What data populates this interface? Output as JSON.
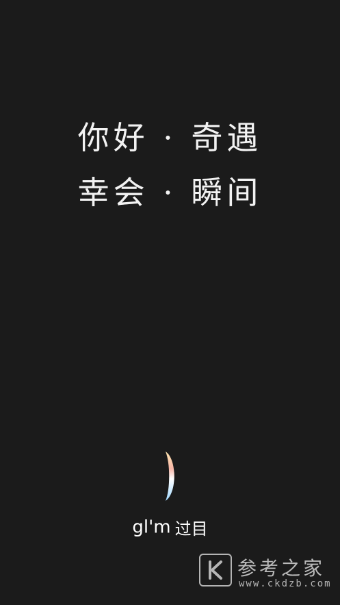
{
  "splash": {
    "line1": "你好 · 奇遇",
    "line2": "幸会 · 瞬间"
  },
  "brand": {
    "logo_icon": "crescent-moon-icon",
    "name_en": "gl'm",
    "name_cn": "过目"
  },
  "watermark": {
    "icon": "k-logo-icon",
    "title": "参考之家",
    "url": "www.ckdzb.com"
  },
  "colors": {
    "background": "#1b1b1b",
    "text": "#ffffff",
    "moon_gradient": [
      "#ffe6b0",
      "#f7b6a8",
      "#ffffff",
      "#9fd8ff"
    ]
  }
}
